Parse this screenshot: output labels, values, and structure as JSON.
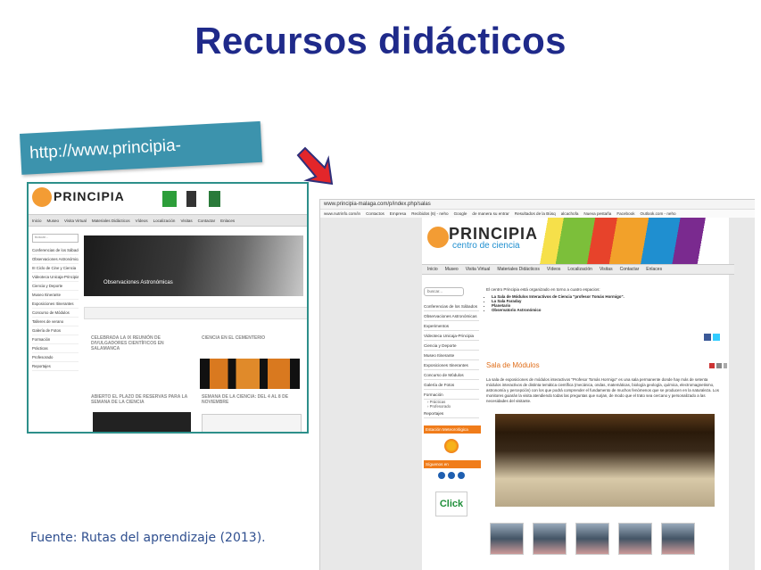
{
  "slide": {
    "title": "Recursos didácticos",
    "url_banner": "http://www.principia-malaga.com/p/",
    "caption": "Fuente: Rutas del aprendizaje (2013)."
  },
  "left_shot": {
    "brand": "PRINCIPIA",
    "nav": [
      "Inicio",
      "Museo",
      "Visita Virtual",
      "Materiales Didácticos",
      "Vídeos",
      "Localización",
      "Visitas",
      "Contactar",
      "Enlaces"
    ],
    "search_placeholder": "buscar...",
    "sidebar": [
      "Conferencias de los Sábados",
      "Observaciones Astronómicas",
      "III Ciclo de Cine y Ciencia",
      "Videoteca Unicaja-Principia",
      "Ciencia y Deporte",
      "Museo Itinerante",
      "Exposiciones Itinerantes",
      "Concurso de Módulos",
      "Talleres de verano",
      "Galería de Fotos",
      "Formación",
      "Prácticas",
      "Profesorado",
      "Reportajes"
    ],
    "hero_caption": "Observaciones Astronómicas",
    "news": [
      "CELEBRADA LA IX REUNIÓN DE DIVULGADORES CIENTÍFICOS EN SALAMANCA",
      "CIENCIA EN EL CEMENTERIO",
      "ABIERTO EL PLAZO DE RESERVAS PARA LA SEMANA DE LA CIENCIA",
      "SEMANA DE LA CIENCIA: DEL 4 AL 8 DE NOVIEMBRE"
    ]
  },
  "right_shot": {
    "address": "www.principia-malaga.com/p/index.php/salas",
    "bookmarks": [
      "www.nutrinfo.com/in",
      "Contactos",
      "Empresa",
      "Recibidos (6) - neho",
      "Google",
      "de manera su entrar",
      "Resultados de la Búsq",
      "alcachofa",
      "Nueva pestaña",
      "Facebook",
      "Outlook.com - neho"
    ],
    "brand": "PRINCIPIA",
    "brand_sub": "centro de ciencia",
    "nav": [
      "Inicio",
      "Museo",
      "Visita Virtual",
      "Materiales Didácticos",
      "Vídeos",
      "Localización",
      "Visitas",
      "Contactar",
      "Enlaces"
    ],
    "search_placeholder": "buscar...",
    "sidebar": [
      "Conferencias de los Sábados",
      "Observaciones Astronómicas",
      "Experimentos",
      "Videoteca Unicaja-Principia",
      "Ciencia y Deporte",
      "Museo Itinerante",
      "Exposiciones Itinerantes",
      "Concurso de Módulos",
      "Galería de Fotos",
      "Formación"
    ],
    "sidebar_sub": [
      "› Prácticas",
      "› Profesorado"
    ],
    "sidebar_last": "Reportajes",
    "weather_label": "Estación Meteorológica",
    "follow_label": "Síguenos en",
    "click_label": "Click",
    "intro": "El centro Principia está organizado en torno a cuatro espacios:",
    "spaces": [
      "La Sala de Módulos Interactivos de Ciencia \"profesor Tomás Hormigo\".",
      "La Sala Faraday",
      "Planetario",
      "Observatorio Astronómico"
    ],
    "section_title": "Sala de Módulos",
    "section_body": "La sala de exposiciones de módulos interactivos \"Profesor Tomás Hormigo\" es una sala permanente donde hay más de setenta módulos interactivos de distinta temática científica (mecánica, ondas, matemáticas, biología geología, química, electromagnetismo, astronomía y percepción) con los que podrá comprender el fundamento de muchos fenómenos que se producen en la naturaleza. Los monitores guiarán la visita atendiendo todas las preguntas que surjan, de modo que el trato sea cercano y personalizado a las necesidades del visitante."
  }
}
